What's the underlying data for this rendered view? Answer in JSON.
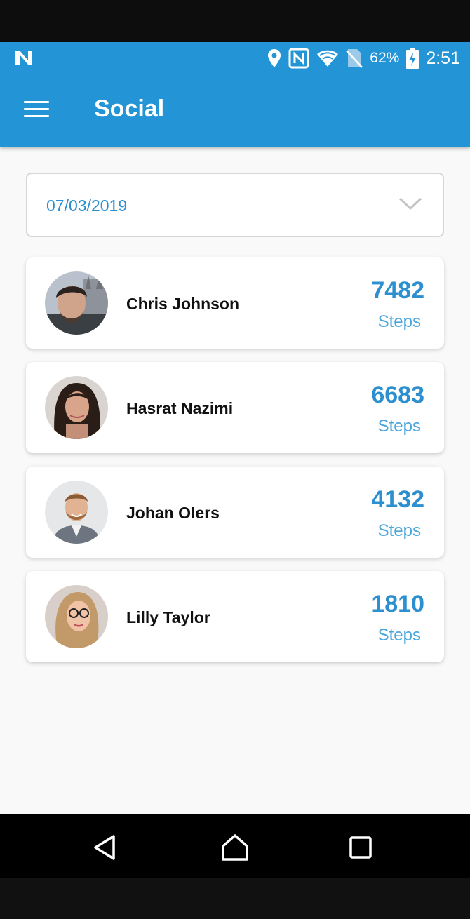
{
  "status_bar": {
    "battery_percent": "62%",
    "time": "2:51",
    "icons": [
      "notification-n-icon",
      "location-icon",
      "nfc-icon",
      "wifi-icon",
      "no-sim-icon",
      "battery-charging-icon"
    ]
  },
  "app_bar": {
    "title": "Social",
    "menu_icon": "hamburger-menu-icon",
    "color": "#2394d6"
  },
  "date_picker": {
    "value": "07/03/2019",
    "icon": "chevron-down-icon"
  },
  "leaderboard": [
    {
      "name": "Chris Johnson",
      "steps": "7482",
      "steps_label": "Steps"
    },
    {
      "name": "Hasrat Nazimi",
      "steps": "6683",
      "steps_label": "Steps"
    },
    {
      "name": "Johan Olers",
      "steps": "4132",
      "steps_label": "Steps"
    },
    {
      "name": "Lilly Taylor",
      "steps": "1810",
      "steps_label": "Steps"
    }
  ],
  "nav_bar": {
    "icons": [
      "back-icon",
      "home-icon",
      "recents-icon"
    ]
  },
  "colors": {
    "accent": "#2b8fd0",
    "background": "#f9f9f9"
  }
}
